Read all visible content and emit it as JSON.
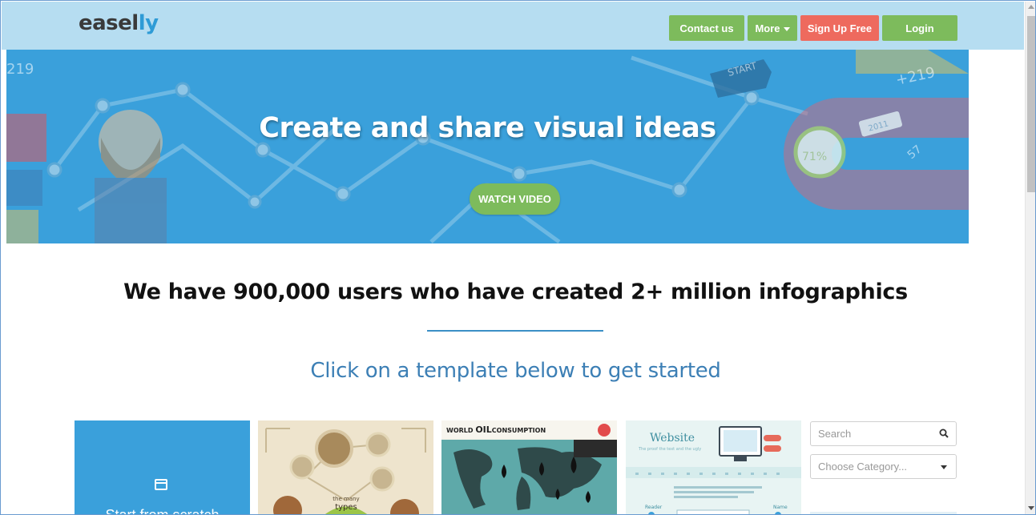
{
  "brand": {
    "logo_main": "easel",
    "logo_accent": "ly"
  },
  "navbar": {
    "contact_label": "Contact us",
    "more_label": "More",
    "signup_label": "Sign Up Free",
    "login_label": "Login"
  },
  "hero": {
    "title": "Create and share visual ideas",
    "watch_label": "WATCH VIDEO",
    "decor": {
      "start": "START",
      "plus": "+219",
      "left_number": "219",
      "year": "2011",
      "percent": "71%",
      "small_number": "57"
    }
  },
  "main": {
    "headline": "We have 900,000 users who have created 2+ million infographics",
    "subhead": "Click on a template below to get started"
  },
  "templates": {
    "scratch_label": "Start from scratch",
    "card_1": {
      "center": "the many",
      "center_main": "types"
    },
    "card_2": {
      "title_prefix": "WORLD ",
      "title_strong": "OIL",
      "title_suffix": "CONSUMPTION"
    },
    "card_3": {
      "title": "Website",
      "subtitle": "The proof the text and the ugly",
      "label_left": "Reader",
      "label_right": "Name"
    }
  },
  "sidebar": {
    "search_placeholder": "Search",
    "category_placeholder": "Choose Category..."
  },
  "colors": {
    "nav_bg": "#b6ddf1",
    "hero_bg": "#3aa0db",
    "green": "#7dbb5c",
    "red": "#ee6a5e",
    "link_blue": "#3c7fb5"
  },
  "icons": [
    "search-icon",
    "caret-down-icon",
    "window-icon"
  ]
}
